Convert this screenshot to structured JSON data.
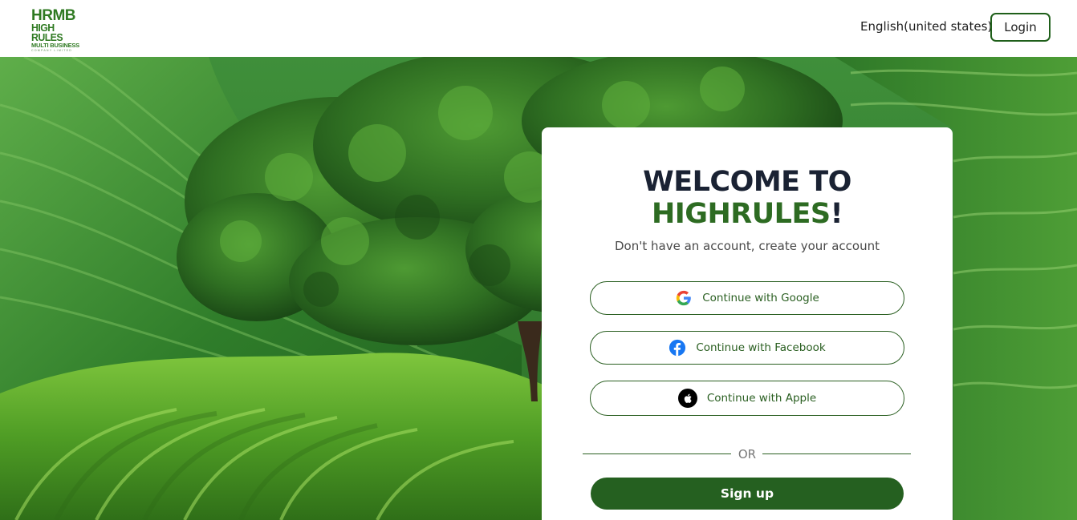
{
  "header": {
    "logo": {
      "line1": "HRMB",
      "line2": "HIGH RULES",
      "line3": "MULTI BUSINESS",
      "line4": "COMPANY LIMITED"
    },
    "language": "English(united states)",
    "login_label": "Login"
  },
  "card": {
    "title_line1": "WELCOME TO",
    "brand_name": "HIGHRULES",
    "brand_suffix": "!",
    "subtitle": "Don't have an account, create your account",
    "google_label": "Continue with Google",
    "facebook_label": "Continue with Facebook",
    "apple_label": "Continue with Apple",
    "or_label": "OR",
    "signup_label": "Sign up"
  },
  "colors": {
    "brand_green": "#256020",
    "logo_green": "#2f7a22",
    "title_dark": "#1a2233"
  },
  "icons": {
    "google": "google-g-icon",
    "facebook": "facebook-icon",
    "apple": "apple-icon"
  }
}
